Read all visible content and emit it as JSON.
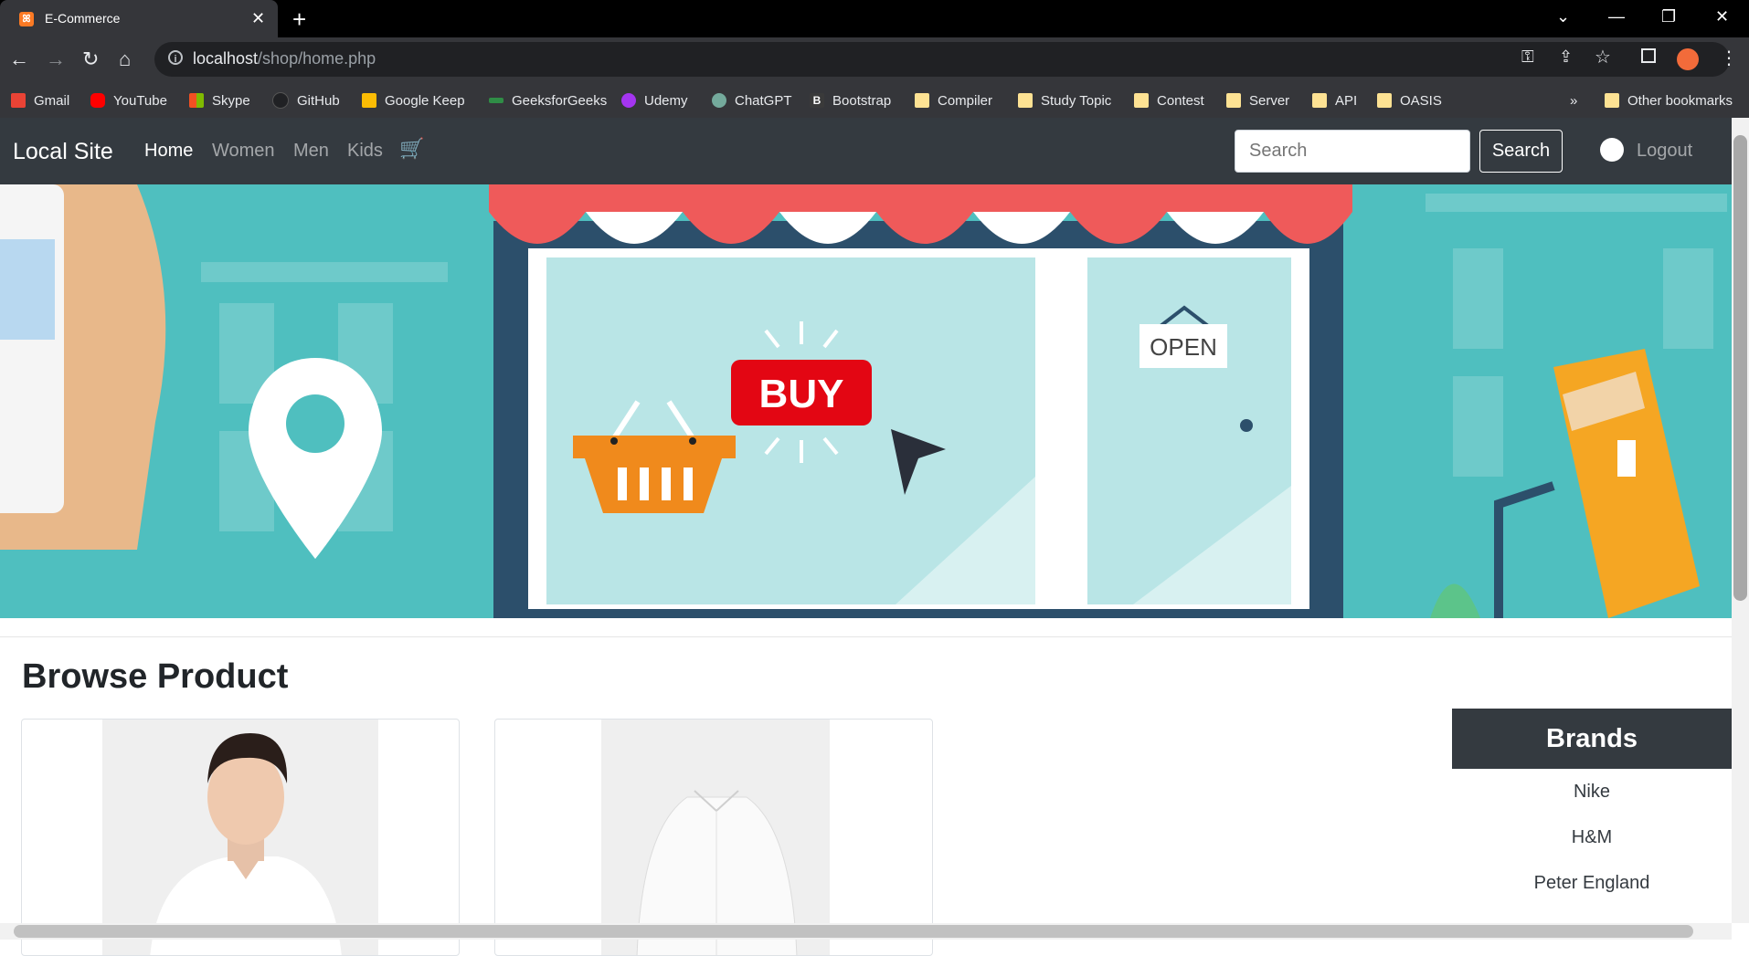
{
  "browser": {
    "tab_title": "E-Commerce",
    "url_host": "localhost",
    "url_path": "/shop/home.php",
    "bookmarks": [
      "Gmail",
      "YouTube",
      "Skype",
      "GitHub",
      "Google Keep",
      "GeeksforGeeks",
      "Udemy",
      "ChatGPT",
      "Bootstrap",
      "Compiler",
      "Study Topic",
      "Contest",
      "Server",
      "API",
      "OASIS"
    ],
    "overflow": "»",
    "other_bookmarks": "Other bookmarks"
  },
  "navbar": {
    "brand": "Local Site",
    "links": [
      "Home",
      "Women",
      "Men",
      "Kids"
    ],
    "search_placeholder": "Search",
    "search_button": "Search",
    "logout": "Logout"
  },
  "hero": {
    "buy_sign": "BUY",
    "open_sign": "OPEN"
  },
  "main": {
    "title": "Browse Product"
  },
  "brands": {
    "header": "Brands",
    "items": [
      "Nike",
      "H&M",
      "Peter England"
    ]
  },
  "colors": {
    "navbar": "#343a40",
    "hero_teal": "#4fbfbf",
    "buy_red": "#e30613"
  }
}
